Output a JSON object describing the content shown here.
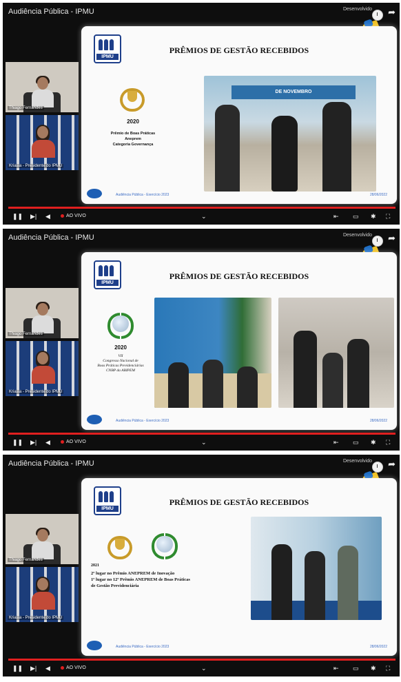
{
  "players": [
    {
      "title": "Audiência Pública - IPMU",
      "watermark": "Desenvolvido",
      "cams": [
        {
          "name": "Thiago Fernandes"
        },
        {
          "name": "Kriasla - Presidente do IPMU"
        }
      ],
      "slide": {
        "heading": "PRÊMIOS DE GESTÃO RECEBIDOS",
        "year": "2020",
        "award_lines": [
          "Prêmio de Boas Práticas",
          "Aneprem",
          "Categoria Governança"
        ],
        "footer_left": "Audiência Pública - Exercício 2023",
        "footer_right": "28/06/2022",
        "photo_banner": "DE NOVEMBRO"
      },
      "controls": {
        "live": "AO VIVO"
      }
    },
    {
      "title": "Audiência Pública - IPMU",
      "watermark": "Desenvolvido",
      "cams": [
        {
          "name": "Thiago Fernandes"
        },
        {
          "name": "Kriasla - Presidente do IPMU"
        }
      ],
      "slide": {
        "heading": "PRÊMIOS DE GESTÃO RECEBIDOS",
        "year": "2020",
        "award_lines": [
          "VII",
          "Congresso Nacional de",
          "Boas Práticas Previdenciárias",
          "CNBP da ABIPEM"
        ],
        "footer_left": "Audiência Pública - Exercício 2023",
        "footer_right": "28/06/2022"
      },
      "controls": {
        "live": "AO VIVO"
      }
    },
    {
      "title": "Audiência Pública - IPMU",
      "watermark": "Desenvolvido",
      "cams": [
        {
          "name": "Thiago Fernandes"
        },
        {
          "name": "Kriasla - Presidente do IPMU"
        }
      ],
      "slide": {
        "heading": "PRÊMIOS DE GESTÃO RECEBIDOS",
        "year": "2021",
        "award_lines": [
          "2º lugar no Prêmio ANEPREM de Inovação",
          "1º lugar no 12º Prêmio ANEPREM de Boas Práticas",
          "de Gestão Previdenciária"
        ],
        "footer_left": "Audiência Pública - Exercício 2023",
        "footer_right": "28/06/2022"
      },
      "controls": {
        "live": "AO VIVO"
      }
    }
  ],
  "ipmu_logo_text": "IPMU",
  "icons": [
    "clock-icon",
    "share-icon",
    "play-pause-icon",
    "next-icon",
    "volume-icon",
    "settings-icon",
    "fullscreen-icon"
  ],
  "colors": {
    "progress": "#e01f1f",
    "brand_blue": "#1e3f8a",
    "gold": "#c89b2a",
    "green": "#2f8b2f"
  }
}
